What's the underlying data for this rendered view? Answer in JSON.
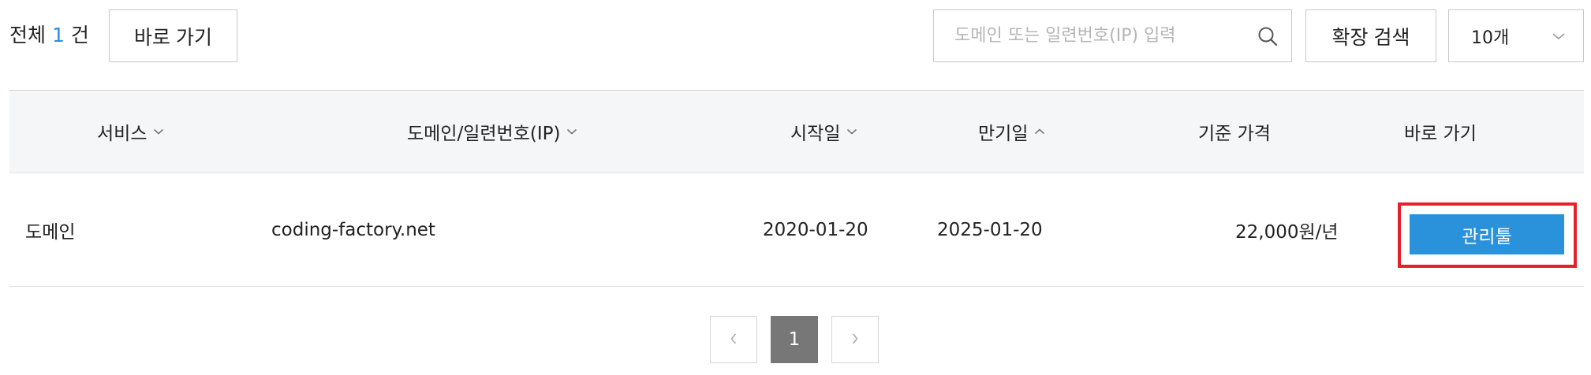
{
  "toolbar": {
    "total_prefix": "전체",
    "total_count": "1",
    "total_suffix": "건",
    "goto_label": "바로 가기",
    "search_placeholder": "도메인 또는 일련번호(IP) 입력",
    "search_value": "",
    "extended_search_label": "확장 검색",
    "page_size_selected": "10개"
  },
  "table": {
    "columns": [
      {
        "label": "서비스",
        "sort": "chevron-down"
      },
      {
        "label": "도메인/일련번호(IP)",
        "sort": "chevron-down"
      },
      {
        "label": "시작일",
        "sort": "chevron-down"
      },
      {
        "label": "만기일",
        "sort": "chevron-up"
      },
      {
        "label": "기준 가격",
        "sort": ""
      },
      {
        "label": "바로 가기",
        "sort": ""
      }
    ],
    "rows": [
      {
        "service": "도메인",
        "domain": "coding-factory.net",
        "start_date": "2020-01-20",
        "expiry_date": "2025-01-20",
        "price": "22,000원/년",
        "action_label": "관리툴"
      }
    ]
  },
  "pagination": {
    "current_page": "1"
  },
  "colors": {
    "accent": "#2a91db",
    "count": "#2a8fd8",
    "highlight": "#e5222c",
    "current_page_bg": "#777777"
  }
}
